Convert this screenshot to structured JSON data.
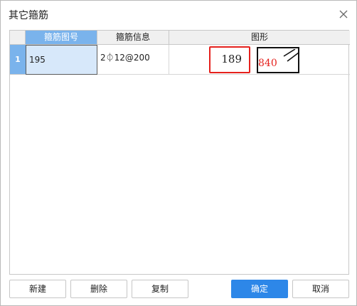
{
  "window": {
    "title": "其它箍筋"
  },
  "table": {
    "columns": [
      "箍筋图号",
      "箍筋信息",
      "图形"
    ],
    "rows": [
      {
        "index": "1",
        "figure_no": "195",
        "info": "2⏀12@200",
        "shape": {
          "value_a": "189",
          "value_b": "840"
        }
      }
    ]
  },
  "buttons": {
    "new": "新建",
    "delete": "删除",
    "copy": "复制",
    "ok": "确定",
    "cancel": "取消"
  },
  "colors": {
    "accent": "#2d87e8",
    "header_active": "#7ab3ec",
    "highlight_red": "#e5211d"
  },
  "icons": {
    "close": "close-icon"
  }
}
